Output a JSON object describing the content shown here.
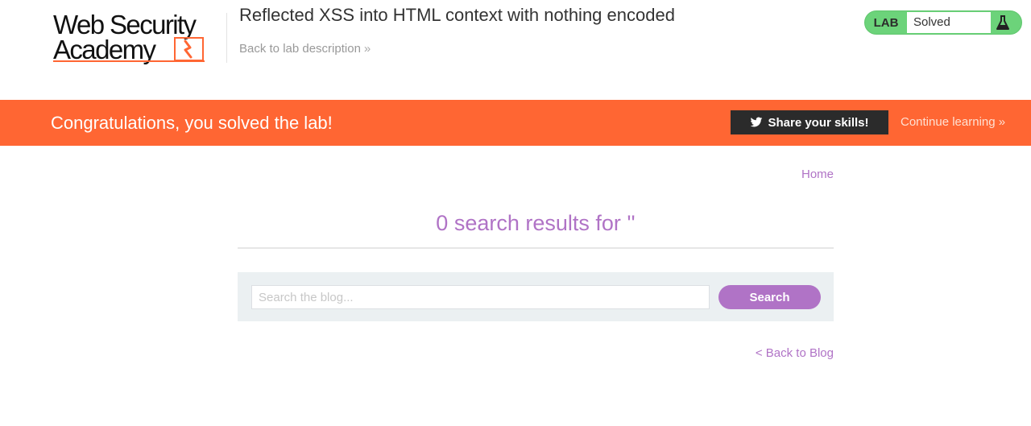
{
  "header": {
    "logo_line1": "Web Security",
    "logo_line2": "Academy",
    "lab_title": "Reflected XSS into HTML context with nothing encoded",
    "back_to_description": "Back to lab description",
    "status": {
      "tag": "LAB",
      "value": "Solved",
      "color": "#6cd37a",
      "icon": "flask-icon"
    }
  },
  "banner": {
    "message": "Congratulations, you solved the lab!",
    "share_label": "Share your skills!",
    "share_icon": "twitter-icon",
    "continue_label": "Continue learning",
    "color": "#ff6633"
  },
  "main": {
    "home_link": "Home",
    "results_heading": "0 search results for ''",
    "search": {
      "placeholder": "Search the blog...",
      "value": "",
      "button_label": "Search"
    },
    "back_to_blog": "< Back to Blog"
  },
  "colors": {
    "accent": "#b073c6",
    "brand_orange": "#ff6633"
  }
}
